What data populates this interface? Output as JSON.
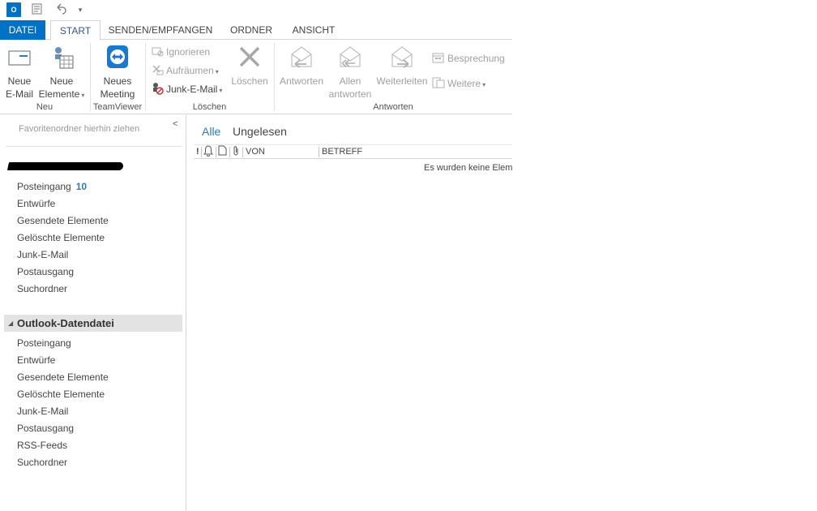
{
  "qat": {
    "logo": "O",
    "icons": [
      "send-receive-all-icon",
      "undo-icon",
      "customize-qat-icon"
    ]
  },
  "tabs": {
    "file": "DATEI",
    "start": "START",
    "send_receive": "SENDEN/EMPFANGEN",
    "folder": "ORDNER",
    "view": "ANSICHT"
  },
  "ribbon": {
    "new_email": {
      "line1": "Neue",
      "line2": "E-Mail"
    },
    "new_items": {
      "line1": "Neue",
      "line2": "Elemente"
    },
    "new_meeting": {
      "line1": "Neues",
      "line2": "Meeting"
    },
    "group_new": "Neu",
    "group_teamviewer": "TeamViewer",
    "ignore": "Ignorieren",
    "cleanup": "Aufräumen",
    "junk": "Junk-E-Mail",
    "delete": "Löschen",
    "group_delete": "Löschen",
    "reply": "Antworten",
    "reply_all": {
      "line1": "Allen",
      "line2": "antworten"
    },
    "forward": "Weiterleiten",
    "meeting": "Besprechung",
    "more": "Weitere",
    "group_respond": "Antworten",
    "accent_color": "#2b579a"
  },
  "nav": {
    "favorites_hint": "Favoritenordner hierhin ziehen",
    "account_folders": [
      {
        "name": "Posteingang",
        "count": "10"
      },
      {
        "name": "Entwürfe"
      },
      {
        "name": "Gesendete Elemente"
      },
      {
        "name": "Gelöschte Elemente"
      },
      {
        "name": "Junk-E-Mail"
      },
      {
        "name": "Postausgang"
      },
      {
        "name": "Suchordner"
      }
    ],
    "datafile_title": "Outlook-Datendatei",
    "datafile_folders": [
      {
        "name": "Posteingang"
      },
      {
        "name": "Entwürfe"
      },
      {
        "name": "Gesendete Elemente"
      },
      {
        "name": "Gelöschte Elemente"
      },
      {
        "name": "Junk-E-Mail"
      },
      {
        "name": "Postausgang"
      },
      {
        "name": "RSS-Feeds"
      },
      {
        "name": "Suchordner"
      }
    ]
  },
  "list": {
    "filter_all": "Alle",
    "filter_unread": "Ungelesen",
    "col_importance": "!",
    "col_from": "VON",
    "col_subject": "BETREFF",
    "empty_text": "Es wurden keine Elem"
  }
}
